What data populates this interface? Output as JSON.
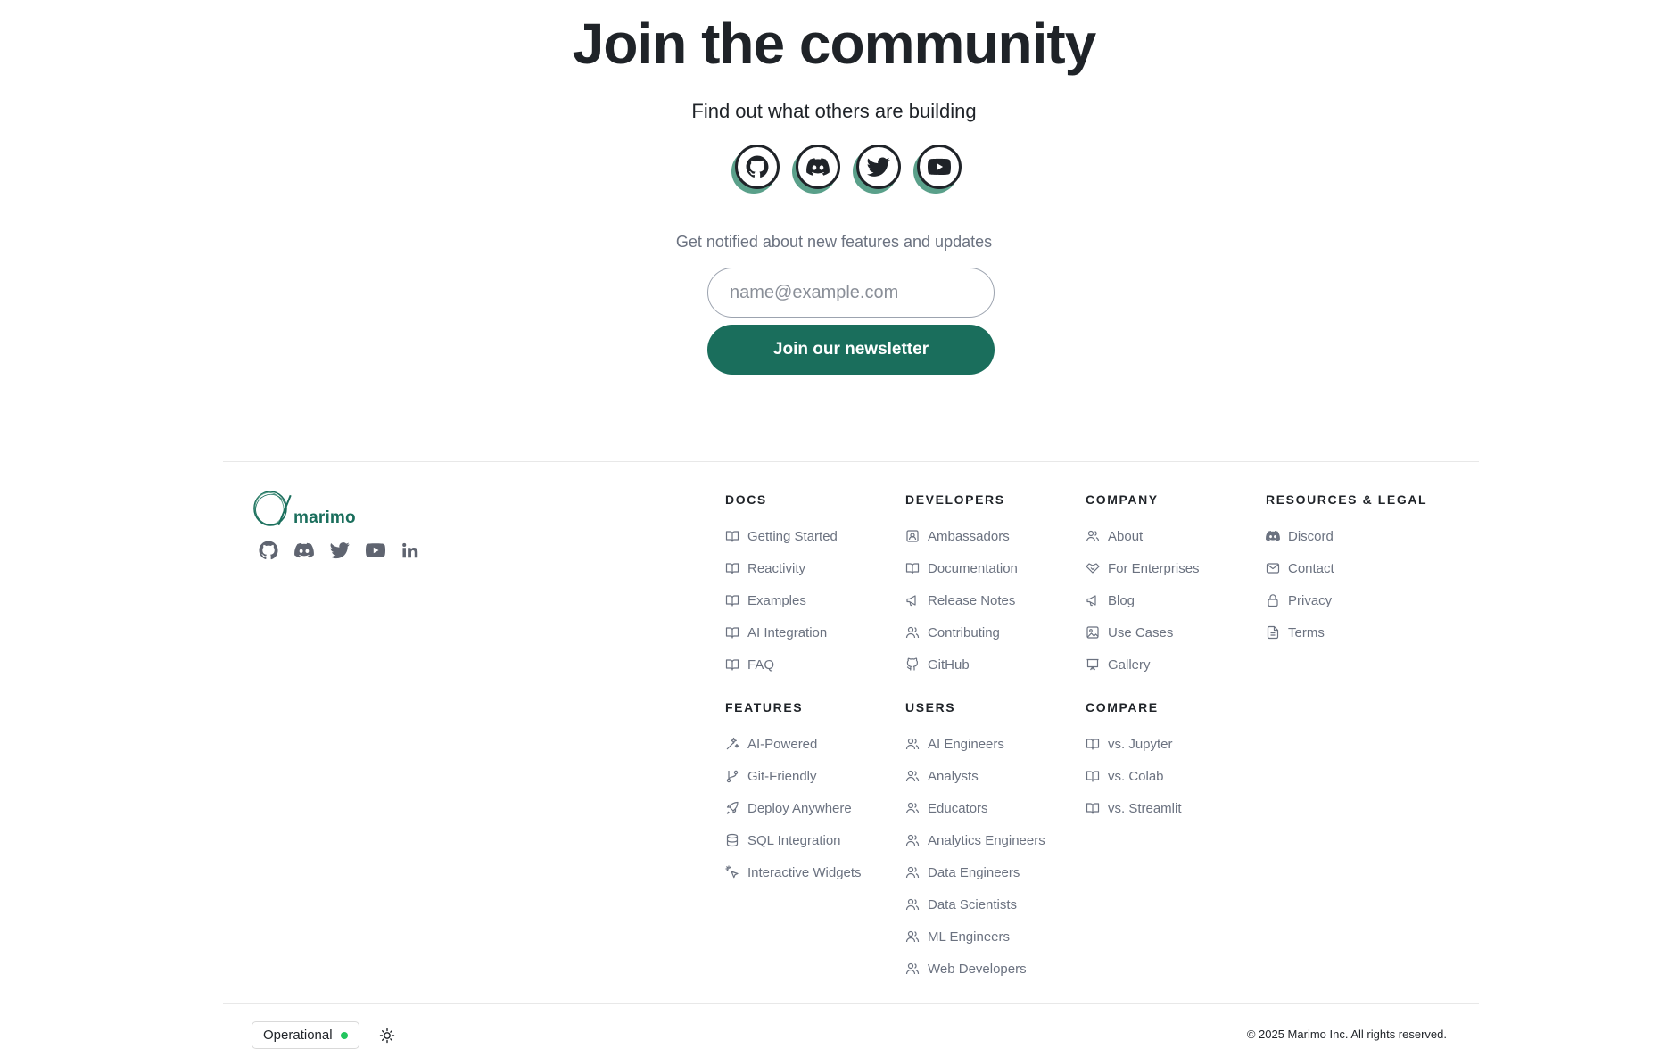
{
  "community": {
    "title": "Join the community",
    "subtitle": "Find out what others are building",
    "social": [
      {
        "name": "github-icon"
      },
      {
        "name": "discord-icon"
      },
      {
        "name": "twitter-icon"
      },
      {
        "name": "youtube-icon"
      }
    ],
    "notify_text": "Get notified about new features and updates",
    "email_placeholder": "name@example.com",
    "newsletter_button": "Join our newsletter"
  },
  "brand": {
    "name": "marimo",
    "color": "#1a6e5c",
    "social_icons": [
      "github-icon",
      "discord-icon",
      "twitter-icon",
      "youtube-icon",
      "linkedin-icon"
    ]
  },
  "columns": {
    "docs": {
      "heading": "DOCS",
      "items": [
        {
          "label": "Getting Started",
          "icon": "book-icon"
        },
        {
          "label": "Reactivity",
          "icon": "book-icon"
        },
        {
          "label": "Examples",
          "icon": "book-icon"
        },
        {
          "label": "AI Integration",
          "icon": "book-icon"
        },
        {
          "label": "FAQ",
          "icon": "book-icon"
        }
      ]
    },
    "developers": {
      "heading": "DEVELOPERS",
      "items": [
        {
          "label": "Ambassadors",
          "icon": "contact-icon"
        },
        {
          "label": "Documentation",
          "icon": "book-icon"
        },
        {
          "label": "Release Notes",
          "icon": "megaphone-icon"
        },
        {
          "label": "Contributing",
          "icon": "users-icon"
        },
        {
          "label": "GitHub",
          "icon": "github-icon"
        }
      ]
    },
    "company": {
      "heading": "COMPANY",
      "items": [
        {
          "label": "About",
          "icon": "users-icon"
        },
        {
          "label": "For Enterprises",
          "icon": "handshake-icon"
        },
        {
          "label": "Blog",
          "icon": "megaphone-icon"
        },
        {
          "label": "Use Cases",
          "icon": "image-icon"
        },
        {
          "label": "Gallery",
          "icon": "presentation-icon"
        }
      ]
    },
    "resources": {
      "heading": "RESOURCES & LEGAL",
      "items": [
        {
          "label": "Discord",
          "icon": "discord-icon"
        },
        {
          "label": "Contact",
          "icon": "mail-icon"
        },
        {
          "label": "Privacy",
          "icon": "lock-icon"
        },
        {
          "label": "Terms",
          "icon": "file-icon"
        }
      ]
    },
    "features": {
      "heading": "FEATURES",
      "items": [
        {
          "label": "AI-Powered",
          "icon": "sparkles-icon"
        },
        {
          "label": "Git-Friendly",
          "icon": "git-branch-icon"
        },
        {
          "label": "Deploy Anywhere",
          "icon": "rocket-icon"
        },
        {
          "label": "SQL Integration",
          "icon": "database-icon"
        },
        {
          "label": "Interactive Widgets",
          "icon": "pointer-icon"
        }
      ]
    },
    "users": {
      "heading": "USERS",
      "items": [
        {
          "label": "AI Engineers",
          "icon": "users-icon"
        },
        {
          "label": "Analysts",
          "icon": "users-icon"
        },
        {
          "label": "Educators",
          "icon": "users-icon"
        },
        {
          "label": "Analytics Engineers",
          "icon": "users-icon"
        },
        {
          "label": "Data Engineers",
          "icon": "users-icon"
        },
        {
          "label": "Data Scientists",
          "icon": "users-icon"
        },
        {
          "label": "ML Engineers",
          "icon": "users-icon"
        },
        {
          "label": "Web Developers",
          "icon": "users-icon"
        }
      ]
    },
    "compare": {
      "heading": "COMPARE",
      "items": [
        {
          "label": "vs. Jupyter",
          "icon": "book-icon"
        },
        {
          "label": "vs. Colab",
          "icon": "book-icon"
        },
        {
          "label": "vs. Streamlit",
          "icon": "book-icon"
        }
      ]
    }
  },
  "bottom_bar": {
    "status": "Operational",
    "status_color": "#22c55e",
    "theme_icon": "sun-icon",
    "copyright": "© 2025 Marimo Inc. All rights reserved."
  }
}
